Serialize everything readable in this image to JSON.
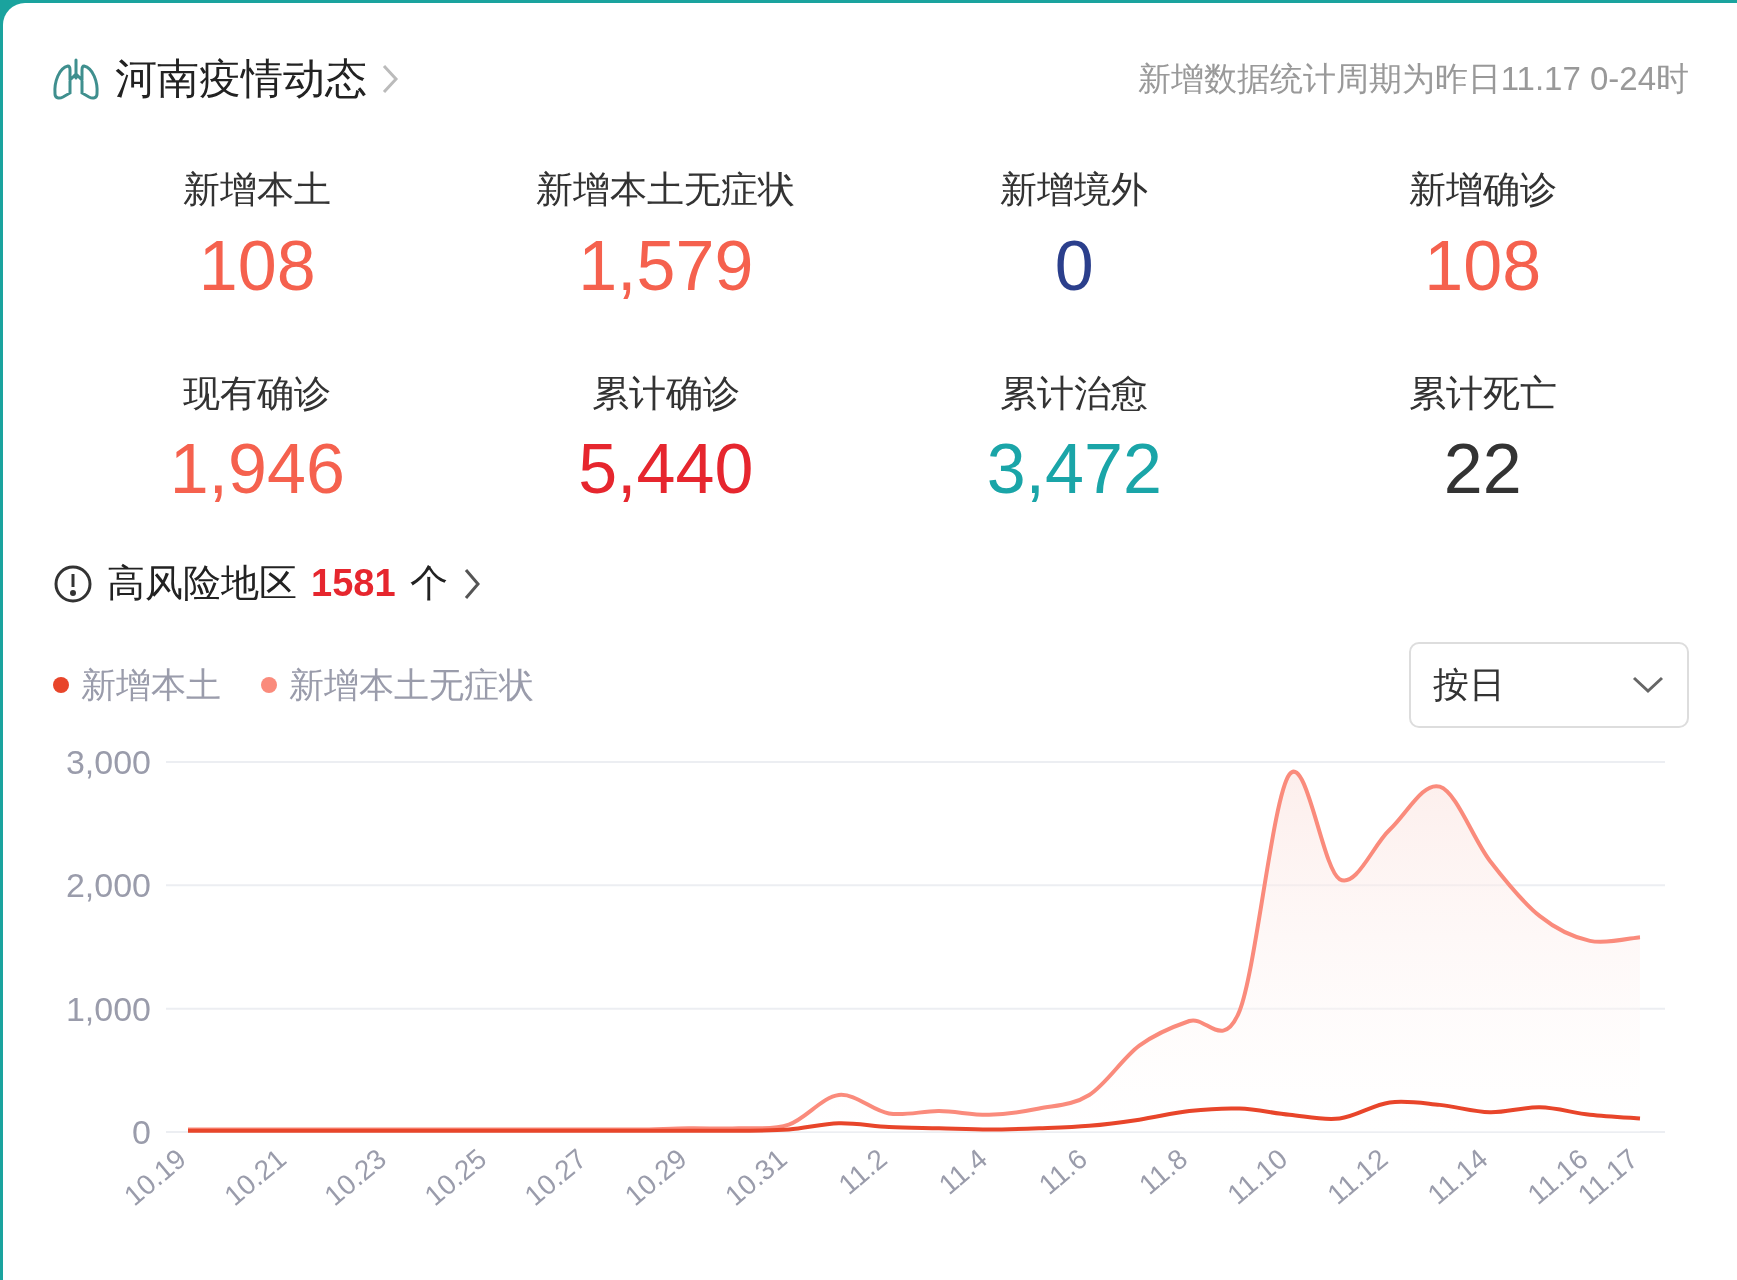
{
  "header": {
    "title": "河南疫情动态",
    "note": "新增数据统计周期为昨日11.17 0-24时"
  },
  "stats": [
    {
      "label": "新增本土",
      "value": "108",
      "color": "#f5614e"
    },
    {
      "label": "新增本土无症状",
      "value": "1,579",
      "color": "#f5614e"
    },
    {
      "label": "新增境外",
      "value": "0",
      "color": "#2b3f8c"
    },
    {
      "label": "新增确诊",
      "value": "108",
      "color": "#f5614e"
    },
    {
      "label": "现有确诊",
      "value": "1,946",
      "color": "#f5614e"
    },
    {
      "label": "累计确诊",
      "value": "5,440",
      "color": "#e6262e"
    },
    {
      "label": "累计治愈",
      "value": "3,472",
      "color": "#1aa5a8"
    },
    {
      "label": "累计死亡",
      "value": "22",
      "color": "#333333"
    }
  ],
  "risk": {
    "label": "高风险地区",
    "count": "1581",
    "unit": "个"
  },
  "period_select": {
    "value": "按日"
  },
  "chart_data": {
    "type": "line",
    "categories": [
      "10.19",
      null,
      "10.21",
      null,
      "10.23",
      null,
      "10.25",
      null,
      "10.27",
      null,
      "10.29",
      null,
      "10.31",
      null,
      "11.2",
      null,
      "11.4",
      null,
      "11.6",
      null,
      "11.8",
      null,
      "11.10",
      null,
      "11.12",
      null,
      "11.14",
      null,
      "11.16",
      "11.17"
    ],
    "ylim": [
      0,
      3000
    ],
    "yticks": [
      {
        "value": 0,
        "label": "0"
      },
      {
        "value": 1000,
        "label": "1,000"
      },
      {
        "value": 2000,
        "label": "2,000"
      },
      {
        "value": 3000,
        "label": "3,000"
      }
    ],
    "series": [
      {
        "name": "新增本土",
        "type": "line",
        "color": "#e8452a",
        "values": [
          10,
          10,
          10,
          10,
          10,
          10,
          10,
          10,
          10,
          10,
          10,
          10,
          20,
          70,
          40,
          30,
          20,
          30,
          50,
          100,
          170,
          190,
          140,
          110,
          240,
          220,
          160,
          200,
          140,
          110
        ]
      },
      {
        "name": "新增本土无症状",
        "type": "area",
        "color": "#fa8b7c",
        "values": [
          20,
          20,
          20,
          20,
          20,
          20,
          20,
          20,
          20,
          20,
          30,
          30,
          60,
          300,
          150,
          170,
          140,
          190,
          300,
          700,
          900,
          980,
          2900,
          2050,
          2450,
          2800,
          2200,
          1750,
          1550,
          1580
        ]
      }
    ]
  }
}
